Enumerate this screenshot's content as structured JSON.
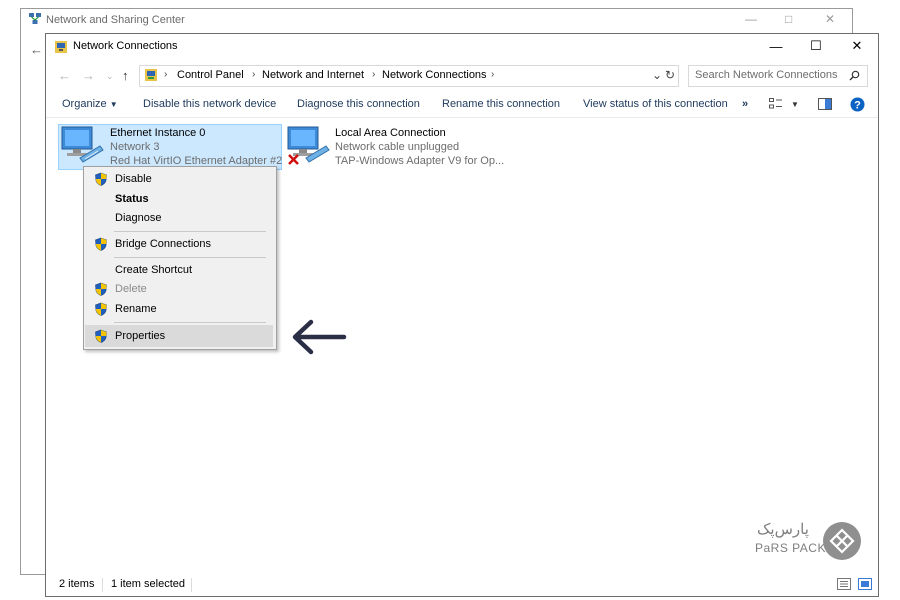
{
  "back_window": {
    "title": "Network and Sharing Center"
  },
  "window": {
    "title": "Network Connections"
  },
  "address": {
    "crumbs": [
      "Control Panel",
      "Network and Internet",
      "Network Connections"
    ],
    "search_placeholder": "Search Network Connections"
  },
  "toolbar": {
    "organize": "Organize",
    "disable": "Disable this network device",
    "diagnose": "Diagnose this connection",
    "rename": "Rename this connection",
    "view_status": "View status of this connection",
    "more": "»"
  },
  "items": [
    {
      "name": "Ethernet Instance 0",
      "network": "Network 3",
      "adapter": "Red Hat VirtIO Ethernet Adapter #2",
      "selected": true
    },
    {
      "name": "Local Area Connection",
      "network": "Network cable unplugged",
      "adapter": "TAP-Windows Adapter V9 for Op...",
      "selected": false
    }
  ],
  "context_menu": {
    "disable": "Disable",
    "status": "Status",
    "diagnose": "Diagnose",
    "bridge": "Bridge Connections",
    "shortcut": "Create Shortcut",
    "delete": "Delete",
    "rename": "Rename",
    "properties": "Properties"
  },
  "status_bar": {
    "count": "2 items",
    "selection": "1 item selected"
  },
  "logo": {
    "text": "PaRS PACK",
    "persian": "پارس‌پک"
  },
  "colors": {
    "accent": "#0078d7",
    "selection": "#cce8ff",
    "arrow": "#2b2f45",
    "shield_blue": "#1f5fbf",
    "shield_yellow": "#f2c300"
  }
}
